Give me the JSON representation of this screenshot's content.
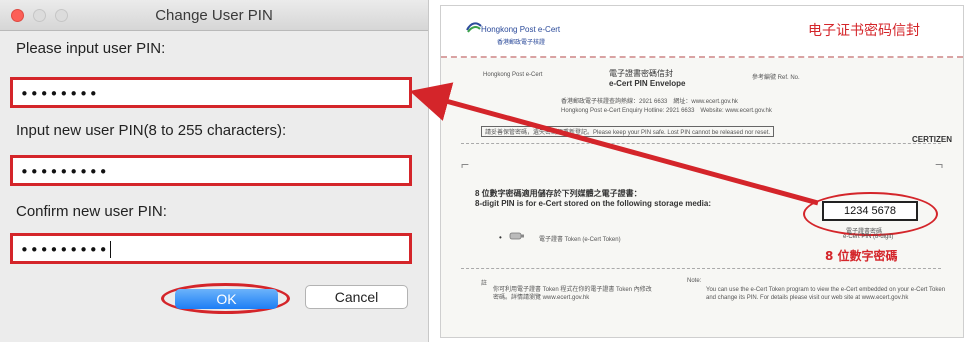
{
  "dialog": {
    "title": "Change User PIN",
    "fields": [
      {
        "label": "Please input user PIN:",
        "value": "••••••••"
      },
      {
        "label": "Input new user PIN(8 to 255 characters):",
        "value": "•••••••••"
      },
      {
        "label": "Confirm new user PIN:",
        "value": "•••••••••"
      }
    ],
    "ok_label": "OK",
    "cancel_label": "Cancel"
  },
  "envelope": {
    "logo_text": "Hongkong Post e-Cert",
    "logo_sub": "香港郵政電子核證",
    "cn_title": "电子证书密码信封",
    "inner_title_cn": "電子證書密碼信封",
    "inner_title_en": "e-Cert PIN Envelope",
    "ref_label": "參考編號 Ref. No.",
    "hotline_cn": "香港郵政電子核證查詢熱線：2921 6633　網址：www.ecert.gov.hk",
    "hotline_en": "Hongkong Post e-Cert Enquiry Hotline: 2921 6633　Website: www.ecert.gov.hk",
    "notice": "請妥善保管密碼，遺失密碼須重新登記。Please keep your PIN safe. Lost PIN cannot be released nor reset.",
    "certizen": "CERTIZEN",
    "storage_cn": "8 位數字密碼適用儲存於下列媒體之電子證書：",
    "storage_en": "8-digit PIN is for e-Cert stored on the following storage media:",
    "token_label": "電子證書 Token (e-Cert Token)",
    "pin_value": "1234 5678",
    "pin_caption": "e-Cert PIN (8-digit)",
    "pin_caption_cn": "電子證書密碼",
    "pin_cn_label": "8 位數字密碼",
    "note_label": "Note:",
    "note_cn": "你可利用電子證書 Token 程式在你的電子證書 Token 內修改密碼。詳情請瀏覽 www.ecert.gov.hk",
    "note_en": "You can use the e-Cert Token program to view the e-Cert embedded on your e-Cert Token and change its PIN. For details please visit our web site at www.ecert.gov.hk",
    "note_cn_label": "註"
  },
  "colors": {
    "highlight": "#d4252a",
    "ok_button": "#1d7ef5"
  }
}
